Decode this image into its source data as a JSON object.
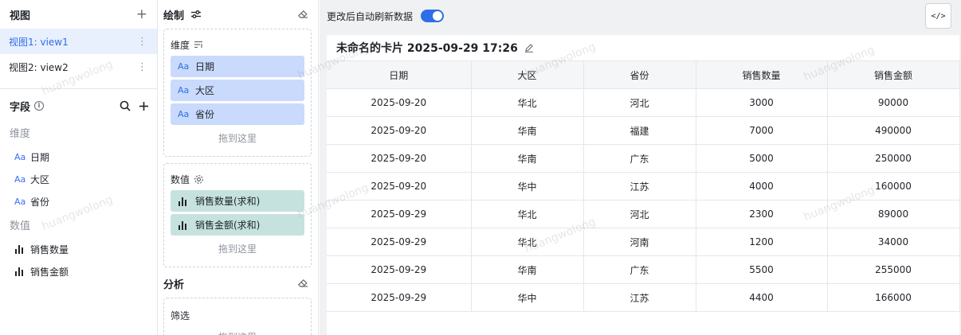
{
  "left": {
    "views_title": "视图",
    "views": [
      {
        "label": "视图1: view1",
        "active": true
      },
      {
        "label": "视图2: view2",
        "active": false
      }
    ],
    "fields_title": "字段",
    "dimension_group": "维度",
    "dimensions": [
      "日期",
      "大区",
      "省份"
    ],
    "measure_group": "数值",
    "measures": [
      "销售数量",
      "销售金额"
    ],
    "dim_prefix": "Aa"
  },
  "middle": {
    "draw_title": "绘制",
    "dimension_box_title": "维度",
    "dimension_pills": [
      "日期",
      "大区",
      "省份"
    ],
    "measure_box_title": "数值",
    "measure_pills": [
      "销售数量(求和)",
      "销售金额(求和)"
    ],
    "dropzone": "拖到这里",
    "analysis_title": "分析",
    "filter_box_title": "筛选"
  },
  "right": {
    "auto_refresh_label": "更改后自动刷新数据",
    "auto_refresh_on": true,
    "code_button": "</>",
    "card_title": "未命名的卡片 2025-09-29 17:26",
    "table": {
      "columns": [
        "日期",
        "大区",
        "省份",
        "销售数量",
        "销售金额"
      ],
      "rows": [
        [
          "2025-09-20",
          "华北",
          "河北",
          "3000",
          "90000"
        ],
        [
          "2025-09-20",
          "华南",
          "福建",
          "7000",
          "490000"
        ],
        [
          "2025-09-20",
          "华南",
          "广东",
          "5000",
          "250000"
        ],
        [
          "2025-09-20",
          "华中",
          "江苏",
          "4000",
          "160000"
        ],
        [
          "2025-09-29",
          "华北",
          "河北",
          "2300",
          "89000"
        ],
        [
          "2025-09-29",
          "华北",
          "河南",
          "1200",
          "34000"
        ],
        [
          "2025-09-29",
          "华南",
          "广东",
          "5500",
          "255000"
        ],
        [
          "2025-09-29",
          "华中",
          "江苏",
          "4400",
          "166000"
        ]
      ]
    }
  },
  "watermark": "huangwolong",
  "colors": {
    "accent": "#2f6ee8",
    "dimension_pill": "#c9dafc",
    "measure_pill": "#c6e2de",
    "active_view_bg": "#e8effd"
  }
}
